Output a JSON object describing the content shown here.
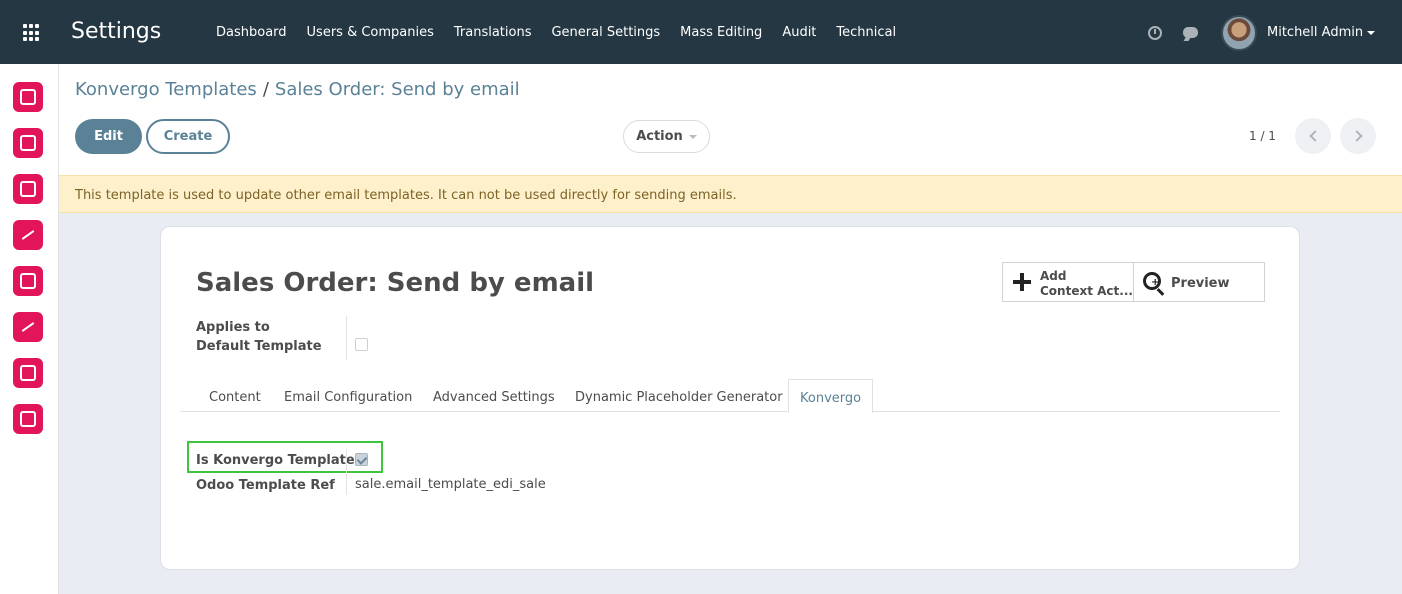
{
  "navbar": {
    "app_title": "Settings",
    "menu": [
      "Dashboard",
      "Users & Companies",
      "Translations",
      "General Settings",
      "Mass Editing",
      "Audit",
      "Technical"
    ],
    "user_name": "Mitchell Admin"
  },
  "sidebar": {
    "items": [
      "discuss-icon",
      "calendar-icon",
      "contacts-icon",
      "crm-icon",
      "accounting-icon",
      "dashboard-icon",
      "sales-icon",
      "settings-icon"
    ],
    "accent": "#e2145a"
  },
  "breadcrumb": {
    "parent": "Konvergo Templates",
    "separator": "/",
    "current": "Sales Order: Send by email"
  },
  "buttons": {
    "edit": "Edit",
    "create": "Create",
    "action": "Action"
  },
  "pager": {
    "value": "1 / 1"
  },
  "alert": {
    "text": "This template is used to update other email templates. It can not be used directly for sending emails."
  },
  "record": {
    "title": "Sales Order: Send by email",
    "smart_buttons": {
      "add_line1": "Add",
      "add_line2": "Context Act...",
      "preview": "Preview"
    },
    "applies_to_line1": "Applies to",
    "applies_to_line2": "Default Template",
    "applies_to_checked": false
  },
  "tabs": [
    "Content",
    "Email Configuration",
    "Advanced Settings",
    "Dynamic Placeholder Generator",
    "Konvergo"
  ],
  "active_tab": "Konvergo",
  "konvergo_fields": {
    "is_template_label": "Is Konvergo Template",
    "is_template_checked": true,
    "template_ref_label": "Odoo Template Ref",
    "template_ref_value": "sale.email_template_edi_sale"
  },
  "colors": {
    "navbar": "#243742",
    "primary": "#5b8197",
    "alert_bg": "#fdf0cb",
    "highlight": "#3fc43f"
  }
}
